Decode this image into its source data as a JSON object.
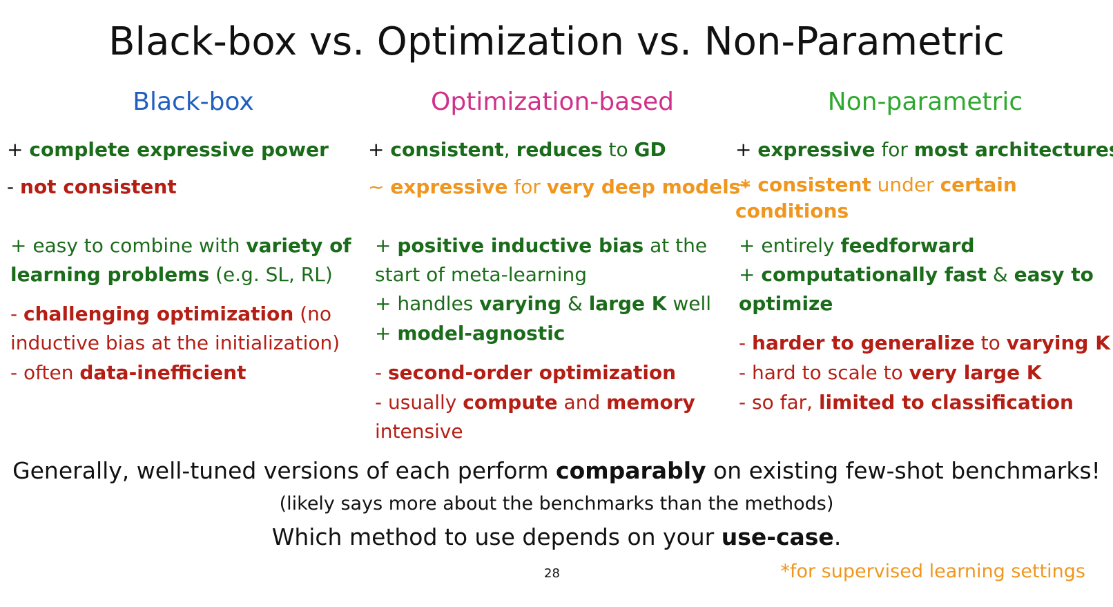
{
  "slide": {
    "title": "Black-box vs. Optimization vs. Non-Parametric",
    "columns": [
      {
        "heading": "Black-box",
        "heading_color": "#1f5fbf"
      },
      {
        "heading": "Optimization-based",
        "heading_color": "#d0308a"
      },
      {
        "heading": "Non-parametric",
        "heading_color": "#2fa82f"
      }
    ],
    "col1": {
      "l1a": "+ ",
      "l1b": "complete expressive power",
      "l2a": "- ",
      "l2b": "not consistent",
      "l3a": "+ easy to combine with ",
      "l3b": "variety of",
      "l4a": "learning problems",
      "l4b": " (e.g. SL, RL)",
      "l5a": "- ",
      "l5b": "challenging optimization",
      "l5c": " (no",
      "l6a": "inductive bias at the initialization)",
      "l7a": "- often ",
      "l7b": "data-inefficient"
    },
    "col2": {
      "l1a": "+ ",
      "l1b": "consistent",
      "l1c": ", ",
      "l1d": "reduces",
      "l1e": " to ",
      "l1f": "GD",
      "l2a": "~ ",
      "l2b": "expressive",
      "l2c": " for ",
      "l2d": "very deep models*",
      "l3a": "+ ",
      "l3b": "positive inductive bias",
      "l3c": " at the",
      "l4a": "start of meta-learning",
      "l5a": "+ handles ",
      "l5b": "varying",
      "l5c": " & ",
      "l5d": "large K",
      "l5e": " well",
      "l6a": "+ ",
      "l6b": "model-agnostic",
      "l7a": "- ",
      "l7b": "second-order optimization",
      "l8a": "- usually ",
      "l8b": "compute",
      "l8c": " and ",
      "l8d": "memory",
      "l9a": "intensive"
    },
    "col3": {
      "l1a": "+ ",
      "l1b": "expressive",
      "l1c": " for ",
      "l1d": "most architectures",
      "l2a": "~ ",
      "l2b": "consistent",
      "l2c": " under ",
      "l2d": "certain",
      "l3a": "conditions",
      "l4a": "+ entirely ",
      "l4b": "feedforward",
      "l5a": "+ ",
      "l5b": "computationally fast",
      "l5c": " & ",
      "l5d": "easy to",
      "l6a": "optimize",
      "l7a": "- ",
      "l7b": "harder to generalize",
      "l7c": " to ",
      "l7d": "varying K",
      "l8a": "- hard to scale to ",
      "l8b": "very large K",
      "l9a": "- so far, ",
      "l9b": "limited to classification"
    },
    "summary": {
      "a": "Generally, well-tuned versions of each perform ",
      "b": "comparably",
      "c": " on existing few-shot benchmarks!"
    },
    "note1": "(likely says more about the benchmarks than the methods)",
    "note2": {
      "a": "Which method to use depends on your ",
      "b": "use-case",
      "c": "."
    },
    "page_number": "28",
    "footnote": "*for supervised learning settings"
  }
}
